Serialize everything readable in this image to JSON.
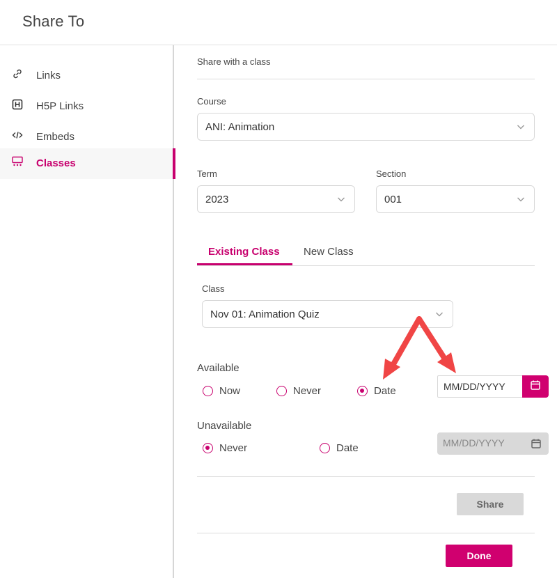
{
  "dialog": {
    "title": "Share To"
  },
  "sidebar": {
    "items": [
      {
        "label": "Links",
        "icon": "link-icon",
        "active": false
      },
      {
        "label": "H5P Links",
        "icon": "h5p-icon",
        "active": false
      },
      {
        "label": "Embeds",
        "icon": "code-icon",
        "active": false
      },
      {
        "label": "Classes",
        "icon": "classroom-icon",
        "active": true
      }
    ]
  },
  "main": {
    "section_title": "Share with a class",
    "course": {
      "label": "Course",
      "value": "ANI: Animation"
    },
    "term": {
      "label": "Term",
      "value": "2023"
    },
    "section": {
      "label": "Section",
      "value": "001"
    },
    "tabs": [
      {
        "label": "Existing Class",
        "active": true
      },
      {
        "label": "New Class",
        "active": false
      }
    ],
    "class_field": {
      "label": "Class",
      "value": "Nov 01: Animation Quiz"
    },
    "available": {
      "label": "Available",
      "options": [
        {
          "label": "Now",
          "selected": false
        },
        {
          "label": "Never",
          "selected": false
        },
        {
          "label": "Date",
          "selected": true
        }
      ],
      "date_placeholder": "MM/DD/YYYY"
    },
    "unavailable": {
      "label": "Unavailable",
      "options": [
        {
          "label": "Never",
          "selected": true
        },
        {
          "label": "Date",
          "selected": false
        }
      ],
      "date_placeholder": "MM/DD/YYYY"
    },
    "share_label": "Share",
    "done_label": "Done"
  },
  "colors": {
    "accent": "#c8006e",
    "arrow": "#f04545",
    "disabled": "#d9d9d9"
  }
}
